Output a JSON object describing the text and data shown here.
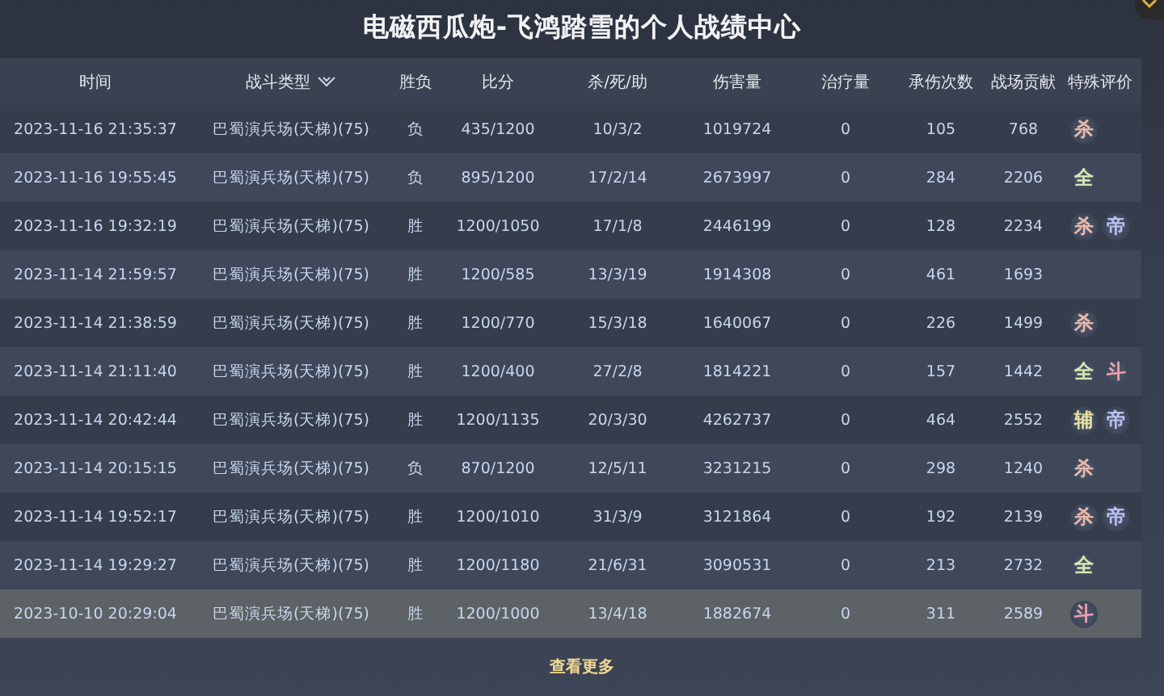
{
  "title": "电磁西瓜炮-飞鸿踏雪的个人战绩中心",
  "columns": [
    {
      "label": "时间"
    },
    {
      "label": "战斗类型",
      "dropdown": true
    },
    {
      "label": "胜负"
    },
    {
      "label": "比分"
    },
    {
      "label": "杀/死/助"
    },
    {
      "label": "伤害量"
    },
    {
      "label": "治疗量"
    },
    {
      "label": "承伤次数"
    },
    {
      "label": "战场贡献"
    },
    {
      "label": "特殊评价"
    }
  ],
  "rows": [
    {
      "selected": false,
      "cells": [
        "2023-11-16 21:35:37",
        "巴蜀演兵场(天梯)(75)",
        "负",
        "435/1200",
        "10/3/2",
        "1019724",
        "0",
        "105",
        "768"
      ],
      "badges": [
        {
          "text": "杀",
          "color": "#e8b8a8"
        }
      ]
    },
    {
      "selected": false,
      "cells": [
        "2023-11-16 19:55:45",
        "巴蜀演兵场(天梯)(75)",
        "负",
        "895/1200",
        "17/2/14",
        "2673997",
        "0",
        "284",
        "2206"
      ],
      "badges": [
        {
          "text": "全",
          "color": "#d8e8b0"
        }
      ]
    },
    {
      "selected": false,
      "cells": [
        "2023-11-16 19:32:19",
        "巴蜀演兵场(天梯)(75)",
        "胜",
        "1200/1050",
        "17/1/8",
        "2446199",
        "0",
        "128",
        "2234"
      ],
      "badges": [
        {
          "text": "杀",
          "color": "#e8b8a8"
        },
        {
          "text": "帝",
          "color": "#b8c0f0"
        }
      ]
    },
    {
      "selected": false,
      "cells": [
        "2023-11-14 21:59:57",
        "巴蜀演兵场(天梯)(75)",
        "胜",
        "1200/585",
        "13/3/19",
        "1914308",
        "0",
        "461",
        "1693"
      ],
      "badges": []
    },
    {
      "selected": false,
      "cells": [
        "2023-11-14 21:38:59",
        "巴蜀演兵场(天梯)(75)",
        "胜",
        "1200/770",
        "15/3/18",
        "1640067",
        "0",
        "226",
        "1499"
      ],
      "badges": [
        {
          "text": "杀",
          "color": "#e8b8a8"
        }
      ]
    },
    {
      "selected": false,
      "cells": [
        "2023-11-14 21:11:40",
        "巴蜀演兵场(天梯)(75)",
        "胜",
        "1200/400",
        "27/2/8",
        "1814221",
        "0",
        "157",
        "1442"
      ],
      "badges": [
        {
          "text": "全",
          "color": "#d8e8b0"
        },
        {
          "text": "斗",
          "color": "#f0a0a8"
        }
      ]
    },
    {
      "selected": false,
      "cells": [
        "2023-11-14 20:42:44",
        "巴蜀演兵场(天梯)(75)",
        "胜",
        "1200/1135",
        "20/3/30",
        "4262737",
        "0",
        "464",
        "2552"
      ],
      "badges": [
        {
          "text": "辅",
          "color": "#e8e0a0"
        },
        {
          "text": "帝",
          "color": "#b8c0f0"
        }
      ]
    },
    {
      "selected": false,
      "cells": [
        "2023-11-14 20:15:15",
        "巴蜀演兵场(天梯)(75)",
        "负",
        "870/1200",
        "12/5/11",
        "3231215",
        "0",
        "298",
        "1240"
      ],
      "badges": [
        {
          "text": "杀",
          "color": "#e8b8a8"
        }
      ]
    },
    {
      "selected": false,
      "cells": [
        "2023-11-14 19:52:17",
        "巴蜀演兵场(天梯)(75)",
        "胜",
        "1200/1010",
        "31/3/9",
        "3121864",
        "0",
        "192",
        "2139"
      ],
      "badges": [
        {
          "text": "杀",
          "color": "#e8b8a8"
        },
        {
          "text": "帝",
          "color": "#b8c0f0"
        }
      ]
    },
    {
      "selected": false,
      "cells": [
        "2023-11-14 19:29:27",
        "巴蜀演兵场(天梯)(75)",
        "胜",
        "1200/1180",
        "21/6/31",
        "3090531",
        "0",
        "213",
        "2732"
      ],
      "badges": [
        {
          "text": "全",
          "color": "#d8e8b0"
        }
      ]
    },
    {
      "selected": true,
      "cells": [
        "2023-10-10 20:29:04",
        "巴蜀演兵场(天梯)(75)",
        "胜",
        "1200/1000",
        "13/4/18",
        "1882674",
        "0",
        "311",
        "2589"
      ],
      "badges": [
        {
          "text": "斗",
          "color": "#f0a0a8"
        }
      ]
    }
  ],
  "more": "查看更多"
}
